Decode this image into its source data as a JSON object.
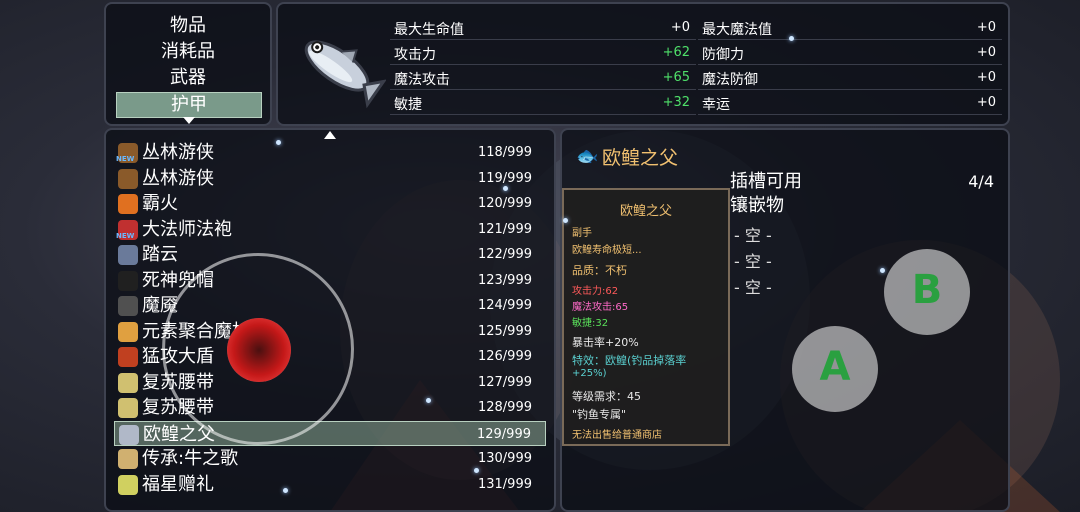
{
  "categories": [
    "物品",
    "消耗品",
    "武器",
    "护甲"
  ],
  "selected_category": "护甲",
  "stats": {
    "left": [
      {
        "name": "最大生命值",
        "value": "+0"
      },
      {
        "name": "攻击力",
        "value": "+62"
      },
      {
        "name": "魔法攻击",
        "value": "+65"
      },
      {
        "name": "敏捷",
        "value": "+32"
      }
    ],
    "right": [
      {
        "name": "最大魔法值",
        "value": "+0"
      },
      {
        "name": "防御力",
        "value": "+0"
      },
      {
        "name": "魔法防御",
        "value": "+0"
      },
      {
        "name": "幸运",
        "value": "+0"
      }
    ]
  },
  "item_list": [
    {
      "name": "丛林游侠",
      "count": "118/999",
      "icon": "boot-icon",
      "new": "NEW",
      "color": "#8a5a2a"
    },
    {
      "name": "丛林游侠",
      "count": "119/999",
      "icon": "boot-icon",
      "new": "",
      "color": "#8a5a2a"
    },
    {
      "name": "霸火",
      "count": "120/999",
      "icon": "fire-ring-icon",
      "new": "",
      "color": "#e07020"
    },
    {
      "name": "大法师法袍",
      "count": "121/999",
      "icon": "robe-icon",
      "new": "NEW",
      "color": "#c03030"
    },
    {
      "name": "踏云",
      "count": "122/999",
      "icon": "cloud-boot-icon",
      "new": "",
      "color": "#6a7a9a"
    },
    {
      "name": "死神兜帽",
      "count": "123/999",
      "icon": "hood-icon",
      "new": "",
      "color": "#202020"
    },
    {
      "name": "魔魇",
      "count": "124/999",
      "icon": "dagger-icon",
      "new": "",
      "color": "#505050"
    },
    {
      "name": "元素聚合魔杖",
      "count": "125/999",
      "icon": "wand-icon",
      "new": "",
      "color": "#e0a040"
    },
    {
      "name": "猛攻大盾",
      "count": "126/999",
      "icon": "shield-icon",
      "new": "",
      "color": "#c04020"
    },
    {
      "name": "复苏腰带",
      "count": "127/999",
      "icon": "belt-icon",
      "new": "",
      "color": "#d0c070"
    },
    {
      "name": "复苏腰带",
      "count": "128/999",
      "icon": "belt-icon",
      "new": "",
      "color": "#d0c070"
    },
    {
      "name": "欧鳇之父",
      "count": "129/999",
      "icon": "fish-icon",
      "new": "",
      "color": "#b0b8c8"
    },
    {
      "name": "传承:牛之歌",
      "count": "130/999",
      "icon": "scroll-icon",
      "new": "",
      "color": "#d0b070"
    },
    {
      "name": "福星赠礼",
      "count": "131/999",
      "icon": "charm-icon",
      "new": "",
      "color": "#d0d060"
    }
  ],
  "selected_item_index": 11,
  "detail": {
    "title": "欧鳇之父",
    "tooltip": {
      "name": "欧鳇之父",
      "slot": "副手",
      "desc": "欧鳇寿命极短...",
      "quality": "品质：不朽",
      "attack": "攻击力:62",
      "magic_attack": "魔法攻击:65",
      "agility": "敏捷:32",
      "crit": "暴击率+20%",
      "special1": "特效：欧鳇(钓品掉落率",
      "special2": "+25%)",
      "level": "等级需求：45",
      "exclusive": "\"钓鱼专属\"",
      "sell": "无法出售给普通商店"
    },
    "socket_line1": "插槽可用",
    "socket_line2": "镶嵌物",
    "socket_count": "4/4",
    "socket_slots": [
      "- 空 -",
      "- 空 -",
      "- 空 -"
    ]
  },
  "buttons": {
    "a": "A",
    "b": "B"
  },
  "colors": {
    "accent_green": "#4fe06a",
    "title_gold": "#f0c070",
    "selected_row": "#8caa96"
  }
}
